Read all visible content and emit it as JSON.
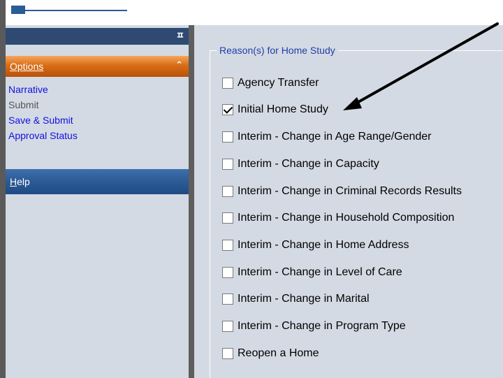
{
  "sidebar": {
    "pin_icon": "pin-icon",
    "options_header": "Options",
    "collapse_icon": "double-chevron-up-icon",
    "options_items": [
      {
        "label": "Narrative",
        "enabled": true
      },
      {
        "label": "Submit",
        "enabled": false
      },
      {
        "label": "Save & Submit",
        "enabled": true
      },
      {
        "label": "Approval Status",
        "enabled": true
      }
    ],
    "help_header_first": "H",
    "help_header_rest": "elp"
  },
  "main": {
    "group_title": "Reason(s) for Home Study",
    "reasons": [
      {
        "label": "Agency Transfer",
        "checked": false
      },
      {
        "label": "Initial Home Study",
        "checked": true
      },
      {
        "label": "Interim - Change in Age Range/Gender",
        "checked": false
      },
      {
        "label": "Interim - Change in Capacity",
        "checked": false
      },
      {
        "label": "Interim - Change in Criminal Records Results",
        "checked": false
      },
      {
        "label": "Interim - Change in Household Composition",
        "checked": false
      },
      {
        "label": "Interim - Change in Home Address",
        "checked": false
      },
      {
        "label": "Interim - Change in Level of Care",
        "checked": false
      },
      {
        "label": "Interim - Change in Marital",
        "checked": false
      },
      {
        "label": "Interim - Change in Program Type",
        "checked": false
      },
      {
        "label": "Reopen a Home",
        "checked": false
      }
    ]
  },
  "colors": {
    "options_accent": "#d96d16",
    "help_accent": "#2b5a95",
    "link": "#1010e0",
    "group_title": "#1f3ea8",
    "panel_bg": "#d4dae3"
  }
}
